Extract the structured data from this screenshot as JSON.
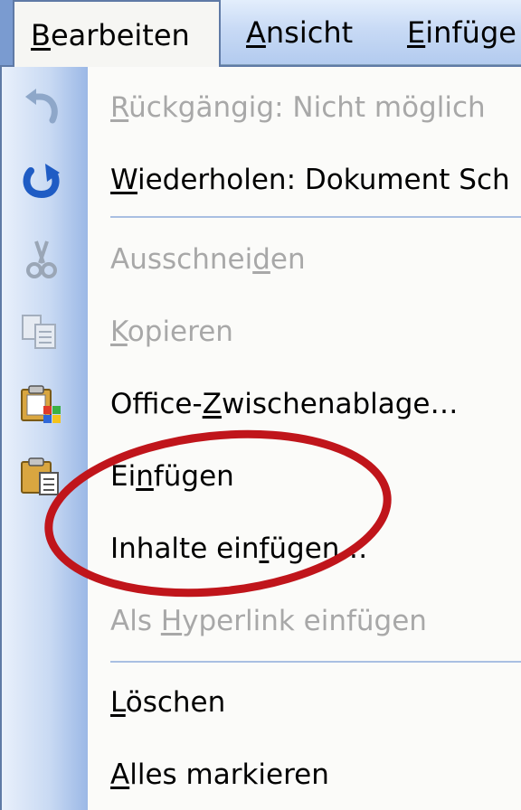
{
  "menubar": {
    "items": [
      {
        "pre": "",
        "mnem": "B",
        "post": "earbeiten",
        "active": true
      },
      {
        "pre": "",
        "mnem": "A",
        "post": "nsicht",
        "active": false
      },
      {
        "pre": "",
        "mnem": "E",
        "post": "infüge",
        "active": false
      }
    ]
  },
  "menu": {
    "items": [
      {
        "pre": "",
        "mnem": "R",
        "post": "ückgängig: Nicht möglich",
        "enabled": false,
        "icon": "undo-icon"
      },
      {
        "pre": "",
        "mnem": "W",
        "post": "iederholen: Dokument Sch",
        "enabled": true,
        "icon": "redo-icon"
      },
      {
        "pre": "Ausschnei",
        "mnem": "d",
        "post": "en",
        "enabled": false,
        "icon": "scissors-icon"
      },
      {
        "pre": "",
        "mnem": "K",
        "post": "opieren",
        "enabled": false,
        "icon": "copy-icon"
      },
      {
        "pre": "Office-",
        "mnem": "Z",
        "post": "wischenablage…",
        "enabled": true,
        "icon": "office-clipboard-icon"
      },
      {
        "pre": "Ei",
        "mnem": "n",
        "post": "fügen",
        "enabled": true,
        "icon": "paste-icon"
      },
      {
        "pre": "Inhalte ein",
        "mnem": "f",
        "post": "ügen…",
        "enabled": true,
        "icon": ""
      },
      {
        "pre": "Als ",
        "mnem": "H",
        "post": "yperlink einfügen",
        "enabled": false,
        "icon": ""
      },
      {
        "pre": "",
        "mnem": "L",
        "post": "öschen",
        "enabled": true,
        "icon": ""
      },
      {
        "pre": "",
        "mnem": "A",
        "post": "lles markieren",
        "enabled": true,
        "icon": ""
      }
    ]
  },
  "colors": {
    "menubar": "#c8daf5",
    "icon_column": "#c9daf3",
    "disabled_text": "#a8a8a8",
    "annotation": "#c0151b"
  }
}
